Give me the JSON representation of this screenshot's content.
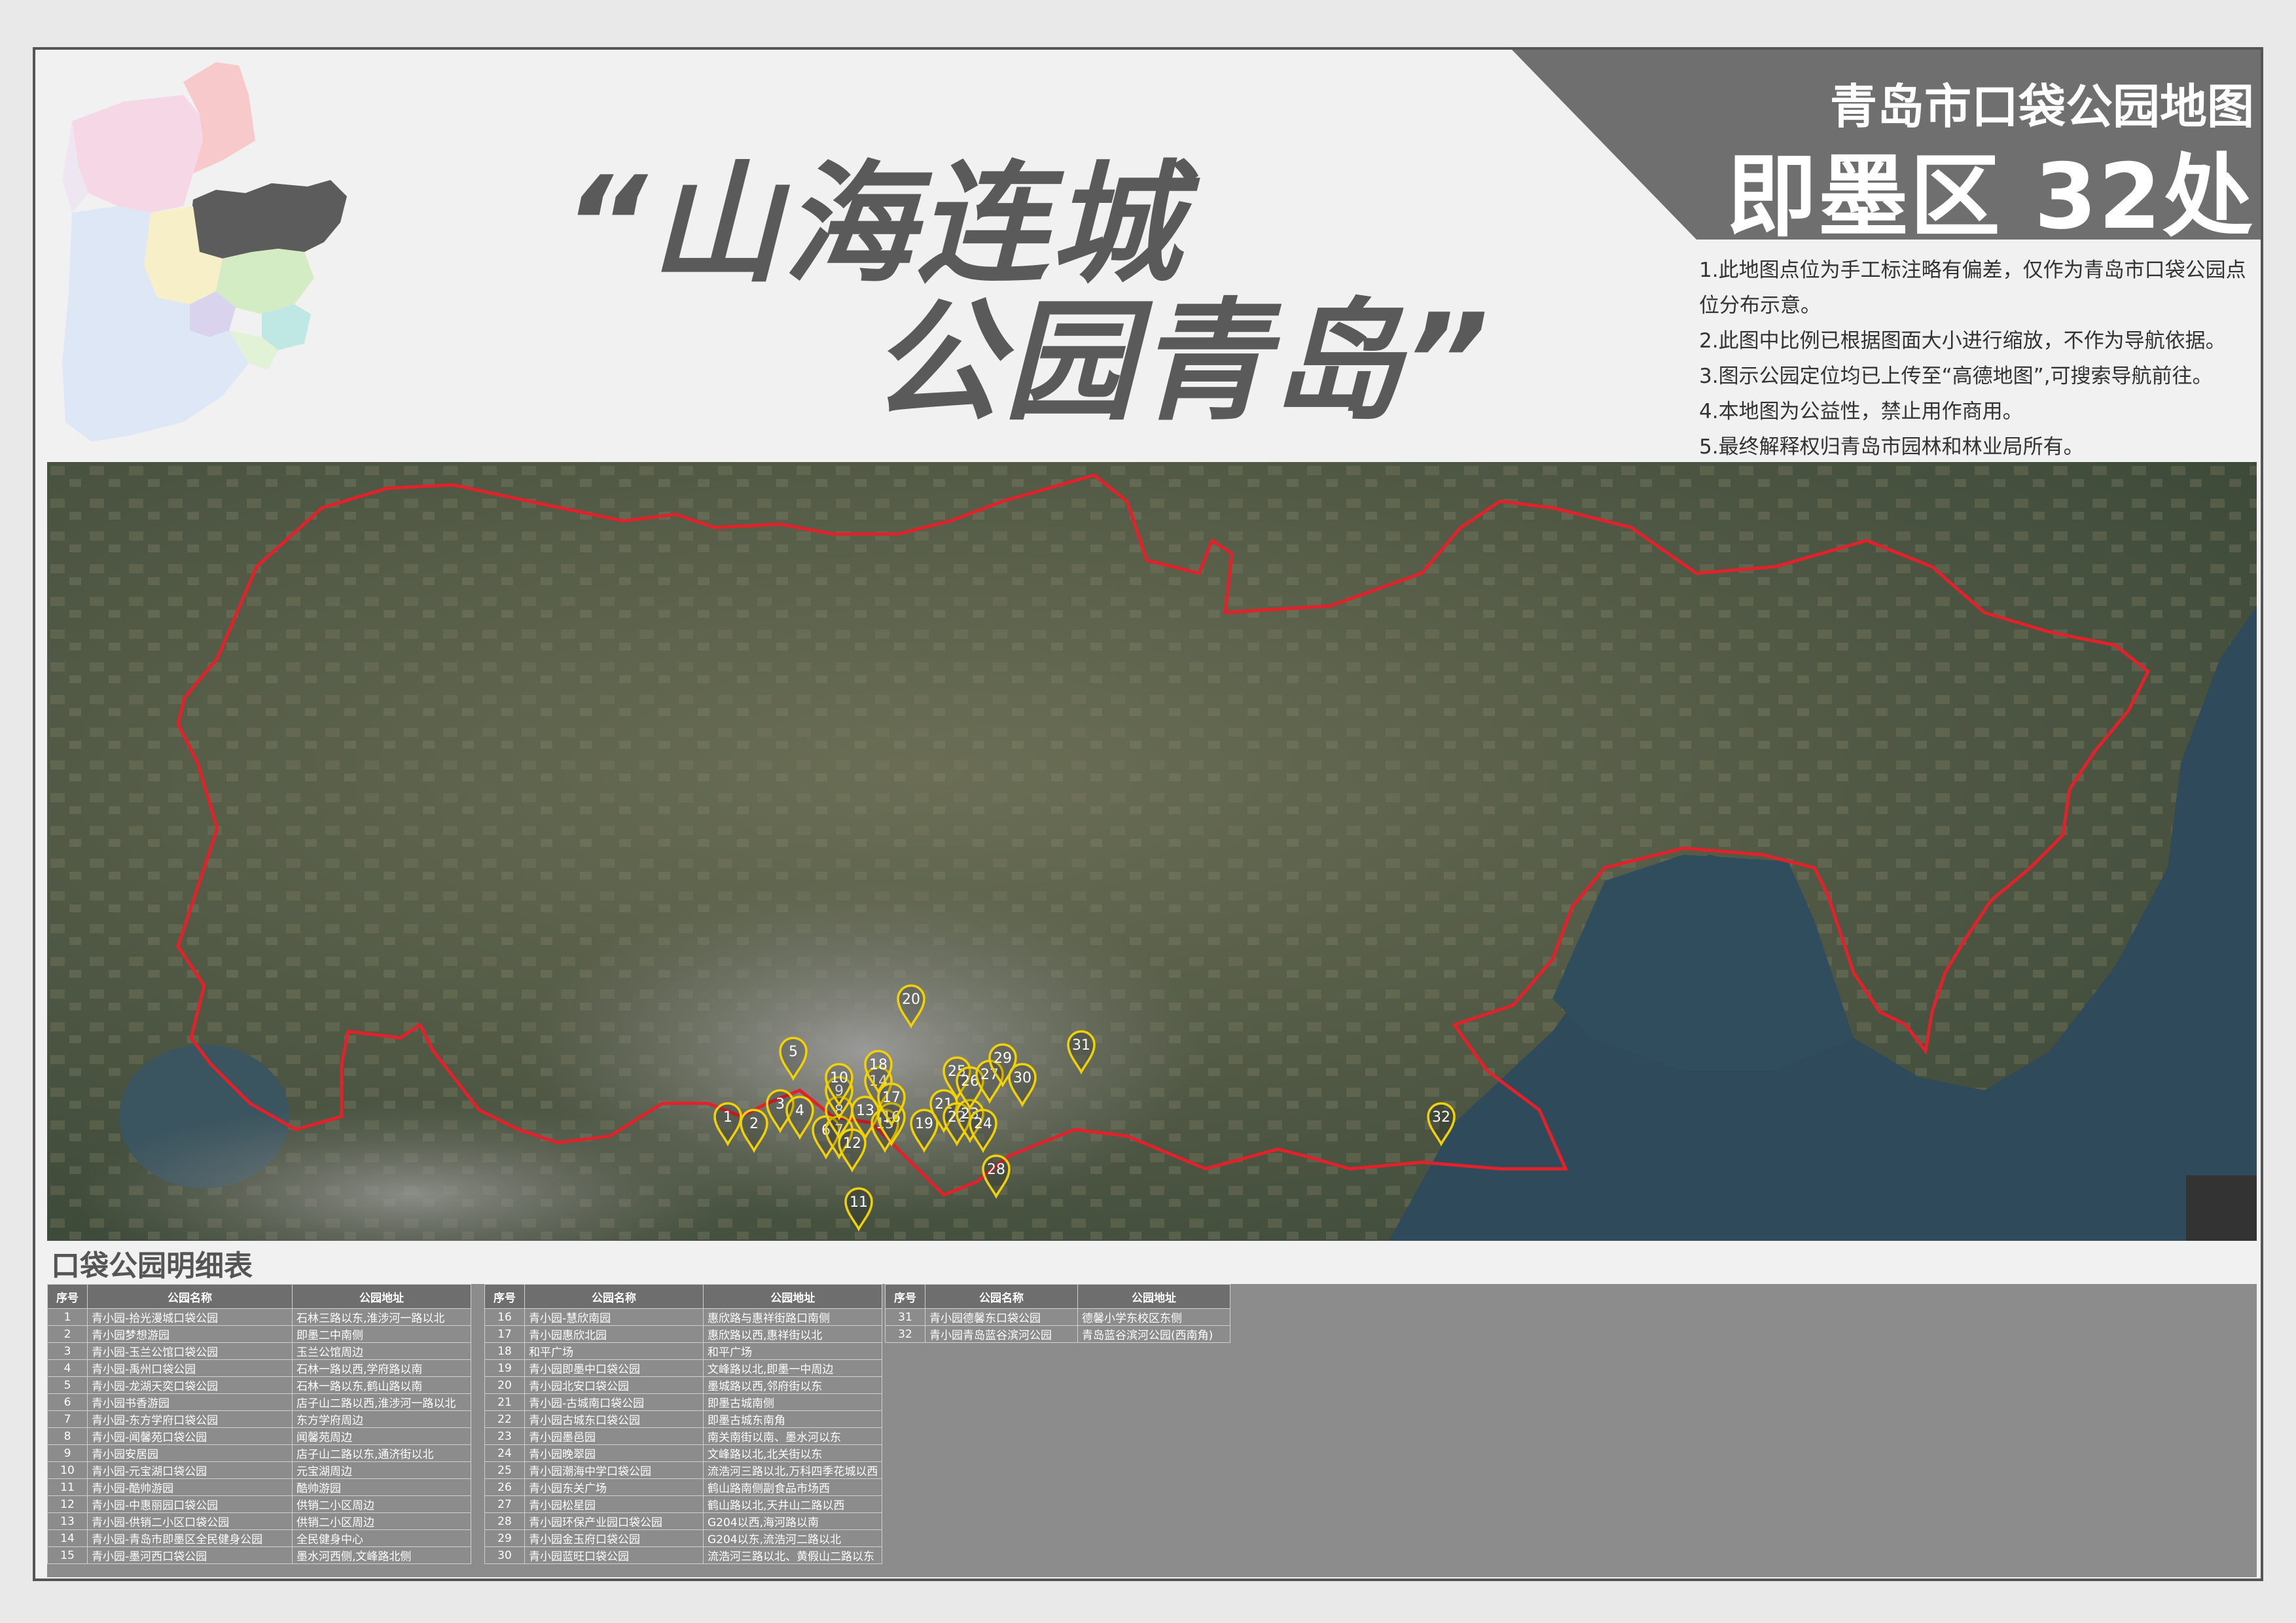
{
  "header": {
    "title_line1": "青岛市口袋公园地图",
    "title_line2": "即墨区 32处",
    "band_color": "#6f6f70"
  },
  "slogan": {
    "line1": "“山海连城",
    "line2": "公园青岛”"
  },
  "notes": [
    "1.此地图点位为手工标注略有偏差，仅作为青岛市口袋公园点位分布示意。",
    "2.此图中比例已根据图面大小进行缩放，不作为导航依据。",
    "3.图示公园定位均已上传至“高德地图”,可搜索导航前往。",
    "4.本地图为公益性，禁止用作商用。",
    "5.最终解释权归青岛市园林和林业局所有。"
  ],
  "map": {
    "boundary_color": "#e0222b",
    "pin_color": "#f2d200",
    "pin_labels": [
      "1",
      "2",
      "3",
      "4",
      "5",
      "6",
      "7",
      "8",
      "9",
      "10",
      "11",
      "12",
      "13",
      "14",
      "15",
      "16",
      "17",
      "18",
      "19",
      "20",
      "21",
      "22",
      "23",
      "24",
      "25",
      "26",
      "27",
      "28",
      "29",
      "30",
      "31",
      "32"
    ]
  },
  "table": {
    "title": "口袋公园明细表",
    "headers": {
      "no": "序号",
      "name": "公园名称",
      "addr": "公园地址"
    },
    "rows": [
      {
        "no": "1",
        "name": "青小园-拾光漫城口袋公园",
        "addr": "石林三路以东,淮涉河一路以北"
      },
      {
        "no": "2",
        "name": "青小园梦想游园",
        "addr": "即墨二中南侧"
      },
      {
        "no": "3",
        "name": "青小园-玉兰公馆口袋公园",
        "addr": "玉兰公馆周边"
      },
      {
        "no": "4",
        "name": "青小园-禹州口袋公园",
        "addr": "石林一路以西,学府路以南"
      },
      {
        "no": "5",
        "name": "青小园-龙湖天奕口袋公园",
        "addr": "石林一路以东,鹤山路以南"
      },
      {
        "no": "6",
        "name": "青小园书香游园",
        "addr": "店子山二路以西,淮涉河一路以北"
      },
      {
        "no": "7",
        "name": "青小园-东方学府口袋公园",
        "addr": "东方学府周边"
      },
      {
        "no": "8",
        "name": "青小园-闻馨苑口袋公园",
        "addr": "闻馨苑周边"
      },
      {
        "no": "9",
        "name": "青小园安居园",
        "addr": "店子山二路以东,通济街以北"
      },
      {
        "no": "10",
        "name": "青小园-元宝湖口袋公园",
        "addr": "元宝湖周边"
      },
      {
        "no": "11",
        "name": "青小园-酷帅游园",
        "addr": "酷帅游园"
      },
      {
        "no": "12",
        "name": "青小园-中惠丽园口袋公园",
        "addr": "供销二小区周边"
      },
      {
        "no": "13",
        "name": "青小园-供销二小区口袋公园",
        "addr": "供销二小区周边"
      },
      {
        "no": "14",
        "name": "青小园-青岛市即墨区全民健身公园",
        "addr": "全民健身中心"
      },
      {
        "no": "15",
        "name": "青小园-墨河西口袋公园",
        "addr": "墨水河西侧,文峰路北侧"
      },
      {
        "no": "16",
        "name": "青小园-慧欣南园",
        "addr": "惠欣路与惠祥街路口南侧"
      },
      {
        "no": "17",
        "name": "青小园惠欣北园",
        "addr": "惠欣路以西,惠祥街以北"
      },
      {
        "no": "18",
        "name": "和平广场",
        "addr": "和平广场"
      },
      {
        "no": "19",
        "name": "青小园即墨中口袋公园",
        "addr": "文峰路以北,即墨一中周边"
      },
      {
        "no": "20",
        "name": "青小园北安口袋公园",
        "addr": "墨城路以西,邻府街以东"
      },
      {
        "no": "21",
        "name": "青小园-古城南口袋公园",
        "addr": "即墨古城南侧"
      },
      {
        "no": "22",
        "name": "青小园古城东口袋公园",
        "addr": "即墨古城东南角"
      },
      {
        "no": "23",
        "name": "青小园墨邑园",
        "addr": "南关南街以南、墨水河以东"
      },
      {
        "no": "24",
        "name": "青小园晚翠园",
        "addr": "文峰路以北,北关街以东"
      },
      {
        "no": "25",
        "name": "青小园潮海中学口袋公园",
        "addr": "流浩河三路以北,万科四季花城以西"
      },
      {
        "no": "26",
        "name": "青小园东关广场",
        "addr": "鹤山路南侧副食品市场西"
      },
      {
        "no": "27",
        "name": "青小园松星园",
        "addr": "鹤山路以北,天井山二路以西"
      },
      {
        "no": "28",
        "name": "青小园环保产业园口袋公园",
        "addr": "G204以西,海河路以南"
      },
      {
        "no": "29",
        "name": "青小园金玉府口袋公园",
        "addr": "G204以东,流浩河二路以北"
      },
      {
        "no": "30",
        "name": "青小园蓝旺口袋公园",
        "addr": "流浩河三路以北、黄假山二路以东"
      },
      {
        "no": "31",
        "name": "青小园德馨东口袋公园",
        "addr": "德馨小学东校区东侧"
      },
      {
        "no": "32",
        "name": "青小园青岛蓝谷滨河公园",
        "addr": "青岛蓝谷滨河公园(西南角)"
      }
    ]
  }
}
